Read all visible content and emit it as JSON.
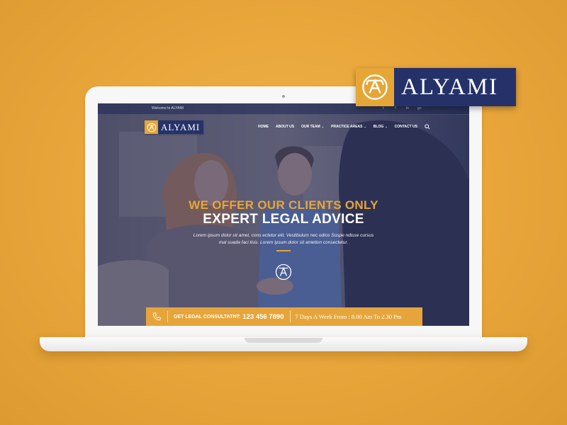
{
  "brand": {
    "name": "ALYAMI",
    "colors": {
      "gold": "#e5a636",
      "navy": "#25326a",
      "background": "#e8a53a"
    }
  },
  "topbar": {
    "welcome": "Welcome to ALYAMI",
    "socials": [
      {
        "icon": "twitter-icon",
        "glyph": "t"
      },
      {
        "icon": "facebook-icon",
        "glyph": "f"
      },
      {
        "icon": "linkedin-icon",
        "glyph": "in"
      },
      {
        "icon": "google-plus-icon",
        "glyph": "g+"
      }
    ]
  },
  "nav": {
    "items": [
      {
        "label": "HOME",
        "dropdown": false
      },
      {
        "label": "ABOUT US",
        "dropdown": false
      },
      {
        "label": "OUR TEAM",
        "dropdown": true
      },
      {
        "label": "PRACTICE AREAS",
        "dropdown": true
      },
      {
        "label": "BLOG",
        "dropdown": true
      },
      {
        "label": "CONTACT US",
        "dropdown": false
      }
    ],
    "caret": "⌄",
    "search_icon": "search-icon"
  },
  "hero": {
    "line1": "WE OFFER OUR CLIENTS ONLY",
    "line2": "EXPERT LEGAL ADVICE",
    "text": "Lorem ipsum dolor sit amet, cons ectetur elit. Vestibulum nec odios Suspe ndisse cursus mal suada faci lisis. Lorem ipsum dolor sit ametion consectetur."
  },
  "cta": {
    "label": "GET LEGAL CONSULTATNT:",
    "phone": "123 456 7890",
    "hours": "7 Days A Week From : 8.00 Am To 2.30 Pm"
  }
}
